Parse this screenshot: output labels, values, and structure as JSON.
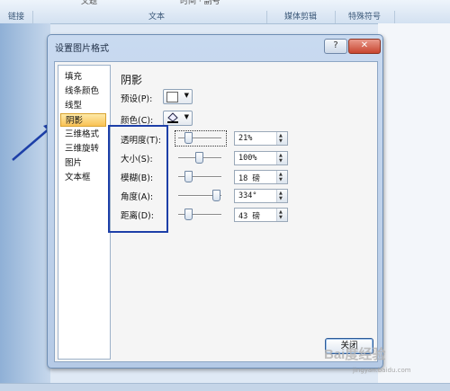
{
  "ribbon": {
    "groups": [
      {
        "label": "链接"
      },
      {
        "label": "文本"
      },
      {
        "label": "媒体剪辑"
      },
      {
        "label": "特殊符号"
      }
    ],
    "top_fragments": [
      "文题",
      "时间 · 副号"
    ]
  },
  "dialog": {
    "title": "设置图片格式",
    "help_label": "?",
    "close_glyph": "✕",
    "nav_items": [
      "填充",
      "线条颜色",
      "线型",
      "阴影",
      "三维格式",
      "三维旋转",
      "图片",
      "文本框"
    ],
    "selected_nav": "阴影",
    "section_heading": "阴影",
    "preset_label": "预设(P):",
    "color_label": "颜色(C):",
    "rows": [
      {
        "label": "透明度(T):",
        "value": "21%"
      },
      {
        "label": "大小(S):",
        "value": "100%"
      },
      {
        "label": "模糊(B):",
        "value": "18 磅"
      },
      {
        "label": "角度(A):",
        "value": "334°"
      },
      {
        "label": "距离(D):",
        "value": "43 磅"
      }
    ],
    "close_button": "关闭"
  },
  "watermark": {
    "text": "Bai度经验",
    "url": "jingyan.baidu.com"
  },
  "colors": {
    "annotation": "#1d3fa8",
    "selected": "#f9c255",
    "arrow": "#1d3fa8"
  }
}
